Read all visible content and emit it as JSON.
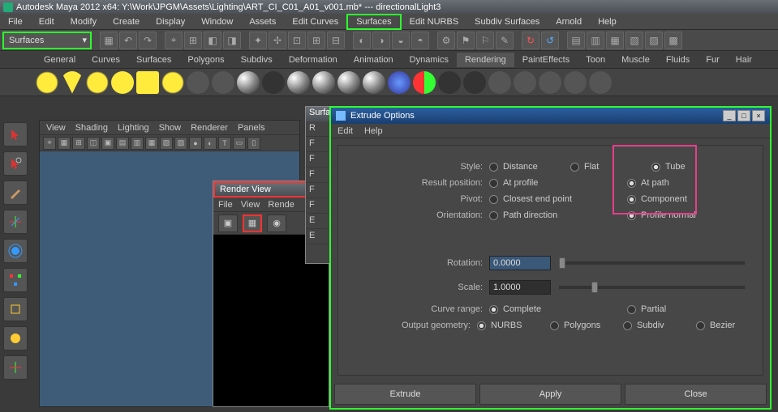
{
  "title": "Autodesk Maya 2012 x64: Y:\\Work\\JPGM\\Assets\\Lighting\\ART_CI_C01_A01_v001.mb*  ---  directionalLight3",
  "menu": [
    "File",
    "Edit",
    "Modify",
    "Create",
    "Display",
    "Window",
    "Assets",
    "Edit Curves",
    "Surfaces",
    "Edit NURBS",
    "Subdiv Surfaces",
    "Arnold",
    "Help"
  ],
  "menu_highlight": "Surfaces",
  "combo": "Surfaces",
  "shelf_tabs": [
    "General",
    "Curves",
    "Surfaces",
    "Polygons",
    "Subdivs",
    "Deformation",
    "Animation",
    "Dynamics",
    "Rendering",
    "PaintEffects",
    "Toon",
    "Muscle",
    "Fluids",
    "Fur",
    "Hair"
  ],
  "shelf_active": "Rendering",
  "viewpanel_menu": [
    "View",
    "Shading",
    "Lighting",
    "Show",
    "Renderer",
    "Panels"
  ],
  "renderview": {
    "title": "Render View",
    "menu": [
      "File",
      "View",
      "Rende"
    ]
  },
  "surfa": {
    "title": "Surfa",
    "rows": [
      "R",
      "F",
      "F",
      "F",
      "F",
      "F",
      "E",
      "E"
    ]
  },
  "extrude": {
    "title": "Extrude Options",
    "menu": [
      "Edit",
      "Help"
    ],
    "rows": {
      "style": {
        "label": "Style:",
        "opts": [
          "Distance",
          "Flat",
          "Tube"
        ],
        "sel": 2
      },
      "result": {
        "label": "Result position:",
        "opts": [
          "At profile",
          "At path"
        ],
        "sel": 1
      },
      "pivot": {
        "label": "Pivot:",
        "opts": [
          "Closest end point",
          "Component"
        ],
        "sel": 1
      },
      "orient": {
        "label": "Orientation:",
        "opts": [
          "Path direction",
          "Profile normal"
        ],
        "sel": 1
      },
      "rotation": {
        "label": "Rotation:",
        "value": "0.0000"
      },
      "scale": {
        "label": "Scale:",
        "value": "1.0000"
      },
      "curverange": {
        "label": "Curve range:",
        "opts": [
          "Complete",
          "Partial"
        ],
        "sel": 0
      },
      "geom": {
        "label": "Output geometry:",
        "opts": [
          "NURBS",
          "Polygons",
          "Subdiv",
          "Bezier"
        ],
        "sel": 0
      }
    },
    "buttons": [
      "Extrude",
      "Apply",
      "Close"
    ]
  }
}
